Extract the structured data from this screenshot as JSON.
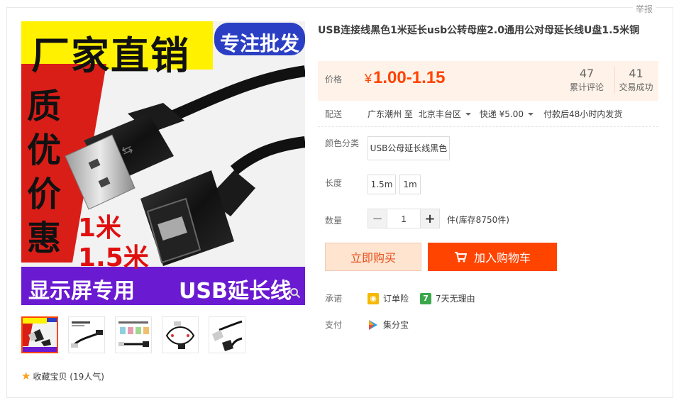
{
  "report_label": "举报",
  "product": {
    "title": "USB连接线黑色1米延长usb公转母座2.0通用公对母延长线U盘1.5米铜",
    "main_image_text": {
      "banner_left": "厂家直销",
      "banner_right": "专注批发",
      "side_chars": [
        "质",
        "优",
        "价",
        "惠"
      ],
      "len1": "1米",
      "len2": "1.5米",
      "bottom_left": "显示屏专用",
      "bottom_right": "USB延长线"
    },
    "thumbnails": [
      "thumb-1",
      "thumb-2",
      "thumb-3",
      "thumb-4",
      "thumb-5"
    ]
  },
  "favorite": {
    "label": "收藏宝贝 (19人气)"
  },
  "price": {
    "label": "价格",
    "currency": "¥",
    "value": "1.00-1.15"
  },
  "stats": {
    "reviews": {
      "num": "47",
      "label": "累计评论"
    },
    "sales": {
      "num": "41",
      "label": "交易成功"
    }
  },
  "shipping": {
    "label": "配送",
    "from_to": "广东潮州 至",
    "dest": "北京丰台区",
    "express": "快递 ¥5.00",
    "promise": "付款后48小时内发货"
  },
  "color": {
    "label": "颜色分类",
    "options": [
      "USB公母延长线黑色"
    ]
  },
  "length": {
    "label": "长度",
    "options": [
      "1.5m",
      "1m"
    ]
  },
  "quantity": {
    "label": "数量",
    "value": "1",
    "minus": "−",
    "plus": "+",
    "stock": "件(库存8750件)"
  },
  "buttons": {
    "buy": "立即购买",
    "cart": "加入购物车"
  },
  "services": {
    "promise_label": "承诺",
    "promise_items": [
      "订单险",
      "7天无理由"
    ],
    "pay_label": "支付",
    "pay_items": [
      "集分宝"
    ]
  },
  "colors": {
    "accent": "#ff4400",
    "price": "#ff4400",
    "buy_bg": "#ffe4d0",
    "price_bg": "#fff2e8"
  }
}
